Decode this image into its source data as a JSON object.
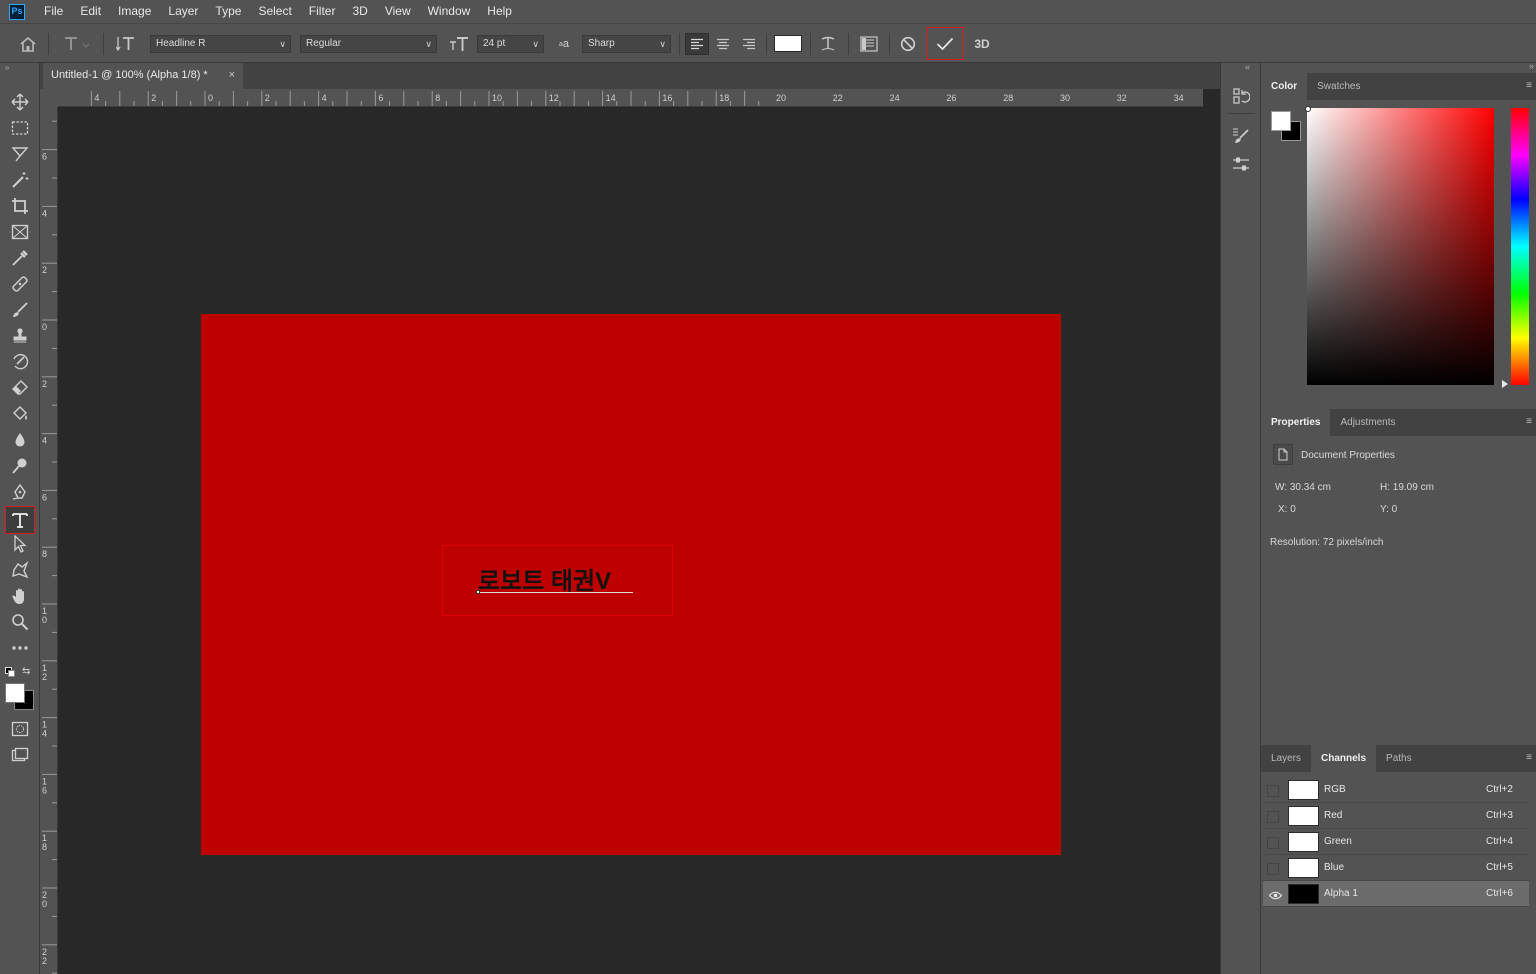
{
  "menu": {
    "items": [
      "File",
      "Edit",
      "Image",
      "Layer",
      "Type",
      "Select",
      "Filter",
      "3D",
      "View",
      "Window",
      "Help"
    ]
  },
  "options": {
    "font_family": "Headline R",
    "font_style": "Regular",
    "font_size": "24 pt",
    "antialias_icon_text": "a",
    "antialias": "Sharp",
    "label_3d": "3D"
  },
  "document": {
    "tab_title": "Untitled-1 @ 100% (Alpha 1/8) *",
    "close_glyph": "×",
    "canvas_color": "#bd0000",
    "text_content": "로보트 태권V"
  },
  "ruler": {
    "h_ticks": [
      "4",
      "2",
      "0",
      "2",
      "4",
      "6",
      "8",
      "10",
      "12",
      "14",
      "16",
      "18",
      "20",
      "22",
      "24",
      "26",
      "28",
      "30",
      "32",
      "34"
    ],
    "v_ticks": [
      "6",
      "4",
      "2",
      "0",
      "2",
      "4",
      "6",
      "8",
      "10",
      "12",
      "14",
      "16",
      "18",
      "20",
      "22"
    ]
  },
  "color_panel": {
    "tabs": [
      "Color",
      "Swatches"
    ],
    "foreground": "#ffffff",
    "background": "#000000"
  },
  "properties_panel": {
    "tabs": [
      "Properties",
      "Adjustments"
    ],
    "heading": "Document Properties",
    "w": "W:  30.34 cm",
    "h": "H:  19.09 cm",
    "x": "X:  0",
    "y": "Y:  0",
    "resolution": "Resolution: 72 pixels/inch"
  },
  "channels_panel": {
    "tabs": [
      "Layers",
      "Channels",
      "Paths"
    ],
    "channels": [
      {
        "name": "RGB",
        "shortcut": "Ctrl+2"
      },
      {
        "name": "Red",
        "shortcut": "Ctrl+3"
      },
      {
        "name": "Green",
        "shortcut": "Ctrl+4"
      },
      {
        "name": "Blue",
        "shortcut": "Ctrl+5"
      },
      {
        "name": "Alpha 1",
        "shortcut": "Ctrl+6"
      }
    ]
  }
}
